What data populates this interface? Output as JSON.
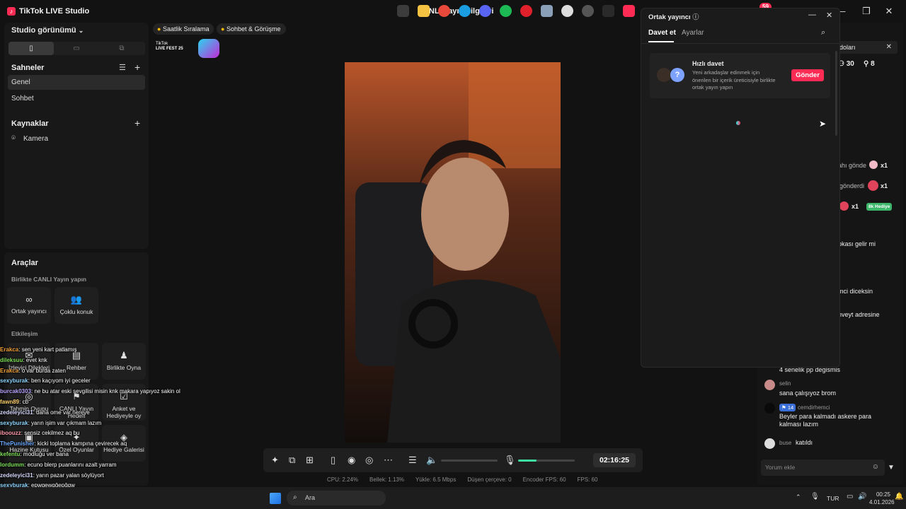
{
  "app": {
    "title": "TikTok LIVE Studio",
    "live_info": "CANLI Yayın bilgileri",
    "notif_count": "59"
  },
  "studio": {
    "view_label": "Studio görünümü",
    "scenes_header": "Sahneler",
    "scenes": [
      "Genel",
      "Sohbet"
    ],
    "sources_header": "Kaynaklar",
    "sources": [
      "Kamera"
    ]
  },
  "tools": {
    "header": "Araçlar",
    "group1": "Birlikte CANLI Yayın yapın",
    "cohost": "Ortak yayıncı",
    "multi_guest": "Çoklu konuk",
    "group2": "Etkileşim",
    "row1": [
      "İzleyici Dilekleri",
      "Rehber",
      "Birlikte Oyna"
    ],
    "row2": [
      "Tahmin Oyunu",
      "CANLI Yayın Hedefi",
      "Anket ve Hediyeyle oy"
    ],
    "row3": [
      "Hazine Kutusu",
      "Özel Oyunlar",
      "Hediye Galerisi"
    ]
  },
  "chips": [
    "Saatlik Sıralama",
    "Sohbet & Görüşme"
  ],
  "fest": {
    "line1": "TikTok",
    "line2": "LIVE FEST 25"
  },
  "chat": [
    {
      "user": "Erakca",
      "text": ": sen yeni kart patlamış",
      "color": "#f2a23a"
    },
    {
      "user": "dileksuu",
      "text": ": evet knk",
      "color": "#7fe05a"
    },
    {
      "user": "Erakca",
      "text": ": o var burda zaten",
      "color": "#f2a23a"
    },
    {
      "user": "sexyburak",
      "text": ": ben kaçıyom iyi geceler",
      "color": "#8fd6ff"
    },
    {
      "user": "burcak0303",
      "text": ": ne bu atar eski sevgilisi misin knk makara yapıyoz sakin ol",
      "color": "#b9a6ff"
    },
    {
      "user": "fawn89",
      "text": ": cb",
      "color": "#ffd36b"
    },
    {
      "user": "zedeleyici31",
      "text": ": daha ome var nereye",
      "color": "#d9d9ff"
    },
    {
      "user": "sexyburak",
      "text": ": yarın işim var çıkmam lazım",
      "color": "#8fd6ff"
    },
    {
      "user": "iboouzz",
      "text": ": sensiz cekilmez aq bu",
      "color": "#ff9aa8"
    },
    {
      "user": "ThePunisher",
      "text": ": kicki toplama kampına çevirecek aq",
      "color": "#6aa8ff"
    },
    {
      "user": "kefentu",
      "text": ": modluğu ver bana",
      "color": "#7fe05a"
    },
    {
      "user": "lordumm",
      "text": ": ecuno blerp puanlarını azalt yarram",
      "color": "#7fe05a"
    },
    {
      "user": "zedeleyici31",
      "text": ": yarın pazar yalan söylüyort",
      "color": "#d9d9ff"
    },
    {
      "user": "sexyburak",
      "text": ": epwqewqğepğqw",
      "color": "#8fd6ff"
    },
    {
      "user": "dileksuu",
      "text": ": ne diyon",
      "color": "#7fe05a"
    }
  ],
  "timer": "02:16:25",
  "stats": [
    "CPU:  2.24%",
    "Bellek:  1.13%",
    "Yükle:  6.5 Mbps",
    "Düşen çerçeve:  0",
    "Encoder FPS:  60",
    "FPS:  60"
  ],
  "cohost": {
    "title": "Ortak yayıncı",
    "tab_invite": "Davet et",
    "tab_settings": "Ayarlar",
    "card_title": "Hızlı davet",
    "card_desc": "Yeni arkadaşlar edinmek için önerilen bir içerik üreticisiyle birlikte ortak yayın yapın",
    "send": "Gönder"
  },
  "right": {
    "field_text": "doları",
    "viewers": "30",
    "likes": "8",
    "gift1": "ahı gönde",
    "gift2": "gönderdi",
    "x1": "x1",
    "gift_badge": "8k Hediye",
    "msg1": "pkası gelir mi",
    "msg2": "mci diceksin",
    "msg3": "nveyt adresine",
    "msg4": "4 senelik pp degismis",
    "selin_name": "selin",
    "selin_msg": "sana çalışıyoz brom",
    "cemdir_level": "14",
    "cemdir_name": "cemdirhemci",
    "cemdir_msg": "Beyler para kalmadı askere para kalması lazım",
    "buse_name": "buse",
    "buse_msg": "katıldı",
    "comment_placeholder": "Yorum ekle"
  },
  "taskbar": {
    "search": "Ara",
    "lang": "TUR",
    "time": "00:25",
    "date": "4.01.2026"
  }
}
